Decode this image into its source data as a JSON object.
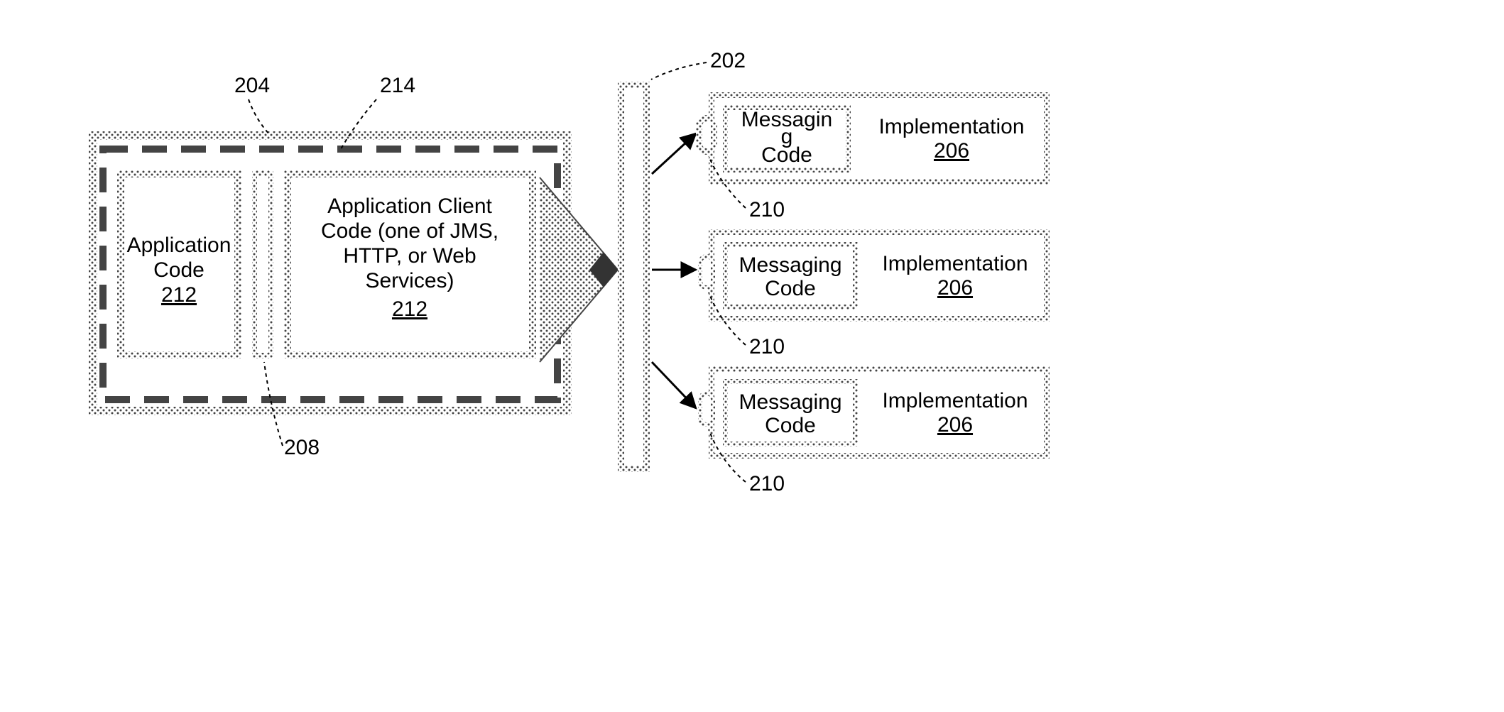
{
  "refs": {
    "bus": "202",
    "client_outer": "204",
    "divider": "208",
    "port": "210",
    "app_code": "212",
    "client_code": "212",
    "dashed_area": "214",
    "impl": "206"
  },
  "boxes": {
    "app_code_l1": "Application",
    "app_code_l2": "Code",
    "client_l1": "Application Client",
    "client_l2": "Code (one of JMS,",
    "client_l3": "HTTP, or Web",
    "client_l4": "Services)",
    "msg_l1": "Messaging",
    "msg_l2": "Code",
    "msg_top_l1": "Messagin",
    "msg_top_l2": "g",
    "msg_top_l3": "Code",
    "impl": "Implementation"
  }
}
